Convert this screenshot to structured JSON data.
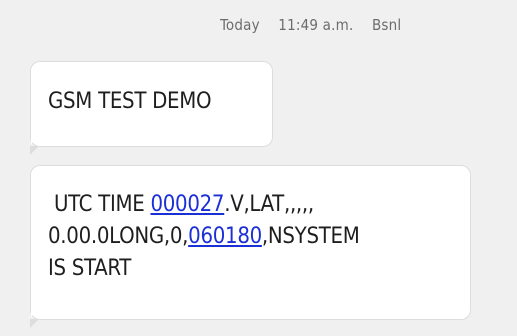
{
  "header": {
    "day": "Today",
    "time": "11:49 a.m.",
    "sender": "Bsnl"
  },
  "messages": [
    {
      "text": "GSM TEST DEMO"
    },
    {
      "line1_a": " UTC TIME ",
      "link1": "000027",
      "line1_b": ".V,LAT,,,,,",
      "line2_a": "0.00.0LONG,0,",
      "link2": "060180",
      "line2_b": ",NSYSTEM",
      "line3": "IS START"
    }
  ],
  "colors": {
    "background": "#f0f0f0",
    "bubble": "#ffffff",
    "link": "#1a2fd6",
    "timestamp": "#6d6d6d"
  }
}
